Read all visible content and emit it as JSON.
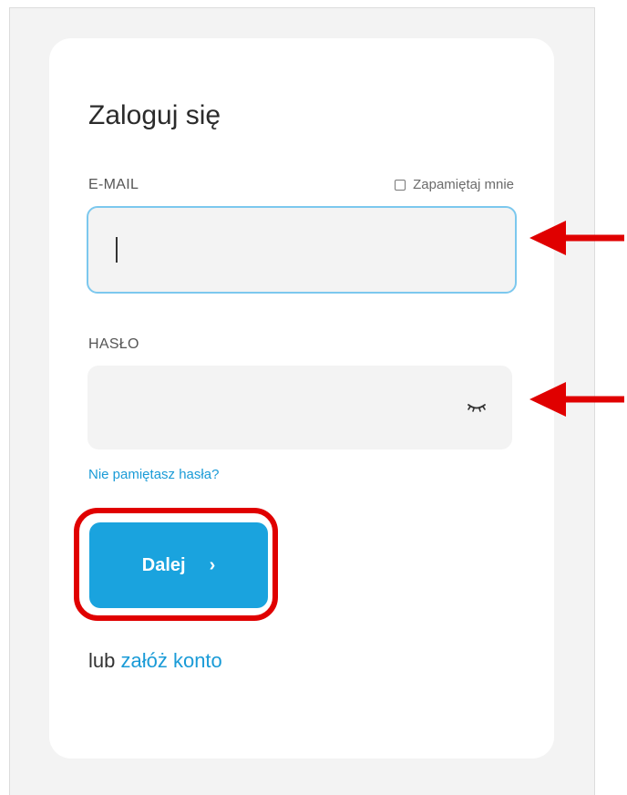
{
  "login": {
    "title": "Zaloguj się",
    "email_label": "E-MAIL",
    "remember_label": "Zapamiętaj mnie",
    "email_value": "",
    "password_label": "HASŁO",
    "password_value": "",
    "forgot_link": "Nie pamiętasz hasła?",
    "submit_label": "Dalej",
    "submit_chevron": "›",
    "alt_prefix": "lub",
    "alt_link": "załóż konto"
  },
  "icons": {
    "password_toggle": "eye-closed-icon",
    "submit_chevron": "chevron-right-icon"
  },
  "colors": {
    "accent": "#1aa3de",
    "link": "#1a9bd7",
    "focus_border": "#7cc8ee",
    "annotation": "#e00000"
  }
}
